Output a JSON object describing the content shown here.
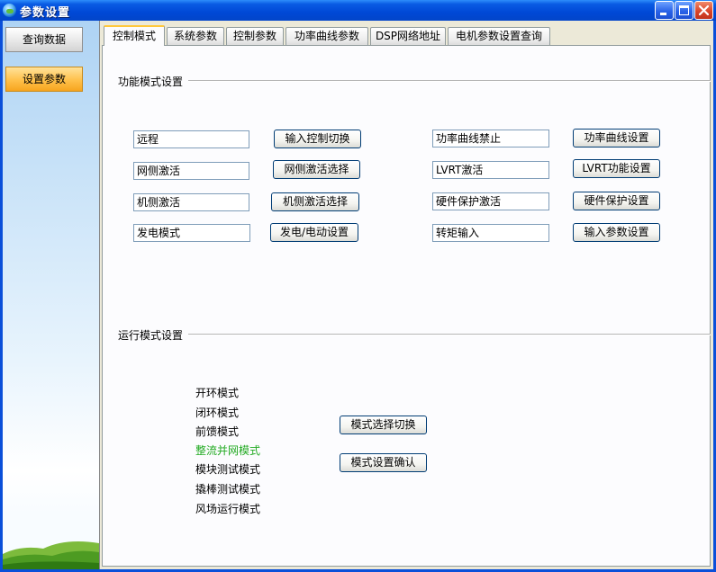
{
  "window": {
    "title": "参数设置",
    "icon": "globe-icon"
  },
  "sidebar": {
    "query_label": "查询数据",
    "settings_label": "设置参数"
  },
  "tabs": [
    "控制模式",
    "系统参数",
    "控制参数",
    "功率曲线参数",
    "DSP网络地址",
    "电机参数设置查询"
  ],
  "function_mode": {
    "title": "功能模式设置",
    "left_rows": [
      {
        "field": "远程",
        "button": "输入控制切换"
      },
      {
        "field": "网侧激活",
        "button": "网侧激活选择"
      },
      {
        "field": "机侧激活",
        "button": "机侧激活选择"
      },
      {
        "field": "发电模式",
        "button": "发电/电动设置"
      }
    ],
    "right_rows": [
      {
        "field": "功率曲线禁止",
        "button": "功率曲线设置"
      },
      {
        "field": "LVRT激活",
        "button": "LVRT功能设置"
      },
      {
        "field": "硬件保护激活",
        "button": "硬件保护设置"
      },
      {
        "field": "转矩输入",
        "button": "输入参数设置"
      }
    ]
  },
  "run_mode": {
    "title": "运行模式设置",
    "modes": [
      "开环模式",
      "闭环模式",
      "前馈模式",
      "整流并网模式",
      "模块测试模式",
      "撬棒测试模式",
      "风场运行模式"
    ],
    "selected": "整流并网模式",
    "selected_color": "#22aa22",
    "switch_button": "模式选择切换",
    "confirm_button": "模式设置确认"
  },
  "colors": {
    "title_bar": "#0a5be4",
    "active_tab_accent": "#ffc83c",
    "settings_button": "#ffc04a"
  }
}
